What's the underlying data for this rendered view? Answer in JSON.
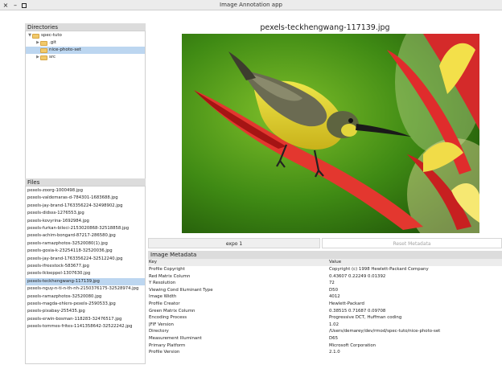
{
  "window": {
    "title": "Image Annotation app",
    "controls": {
      "close": "×",
      "minimize": "–"
    }
  },
  "directories": {
    "header": "Directories",
    "tree": [
      {
        "label": "spec-tuto",
        "expanded": true,
        "selected": false
      },
      {
        "label": ".git",
        "expanded": false,
        "selected": false
      },
      {
        "label": "nice-photo-set",
        "expanded": false,
        "selected": true
      },
      {
        "label": "src",
        "expanded": false,
        "selected": false
      }
    ]
  },
  "files": {
    "header": "Files",
    "items": [
      "pexels-zoorg-1000498.jpg",
      "pexels-valdemaras-d-784301-1683688.jpg",
      "pexels-jay-brand-1763356224-32498902.jpg",
      "pexels-didsss-1276553.jpg",
      "pexels-kovyrina-1692984.jpg",
      "pexels-furkan-bileci-2153020868-32518858.jpg",
      "pexels-achim-bongard-87217-286580.jpg",
      "pexels-ramazphotos-32520080(1).jpg",
      "pexels-gosia-k-23254118-32520036.jpg",
      "pexels-jay-brand-1763356224-32512240.jpg",
      "pexels-ifreestock-583677.jpg",
      "pexels-lkloeppel-1307630.jpg",
      "pexels-teckhengwang-117139.jpg",
      "pexels-nguy-n-ti-n-th-nh-2150376175-32528974.jpg",
      "pexels-ramazphotos-32520080.jpg",
      "pexels-magda-ehlers-pexels-2590533.jpg",
      "pexels-pixabay-255435.jpg",
      "pexels-erwin-bosman-118283-32476517.jpg",
      "pexels-tommes-frites-1141358642-32522242.jpg"
    ],
    "selected_index": 12
  },
  "image": {
    "title": "pexels-teckhengwang-117139.jpg"
  },
  "buttons": {
    "expo": "expo 1",
    "reset": "Reset Metadata"
  },
  "metadata": {
    "header": "Image Metadata",
    "columns": {
      "key": "Key",
      "value": "Value"
    },
    "rows": [
      {
        "key": "Profile Copyright",
        "value": "Copyright (c) 1998 Hewlett-Packard Company"
      },
      {
        "key": "Red Matrix Column",
        "value": "0.43607 0.22249 0.01392"
      },
      {
        "key": "Y Resolution",
        "value": "72"
      },
      {
        "key": "Viewing Cond Illuminant Type",
        "value": "D50"
      },
      {
        "key": "Image Width",
        "value": "4012"
      },
      {
        "key": "Profile Creator",
        "value": "Hewlett-Packard"
      },
      {
        "key": "Green Matrix Column",
        "value": "0.38515 0.71687 0.09708"
      },
      {
        "key": "Encoding Process",
        "value": "Progressive DCT, Huffman coding"
      },
      {
        "key": "JFIF Version",
        "value": "1.02"
      },
      {
        "key": "Directory",
        "value": "/Users/demarey/dev/rmod/spec-tuto/nice-photo-set"
      },
      {
        "key": "Measurement Illuminant",
        "value": "D65"
      },
      {
        "key": "Primary Platform",
        "value": "Microsoft Corporation"
      },
      {
        "key": "Profile Version",
        "value": "2.1.0"
      }
    ]
  },
  "colors": {
    "selection": "#bcd6f0",
    "section_header": "#dcdcdc",
    "folder": "#f1c96b"
  }
}
